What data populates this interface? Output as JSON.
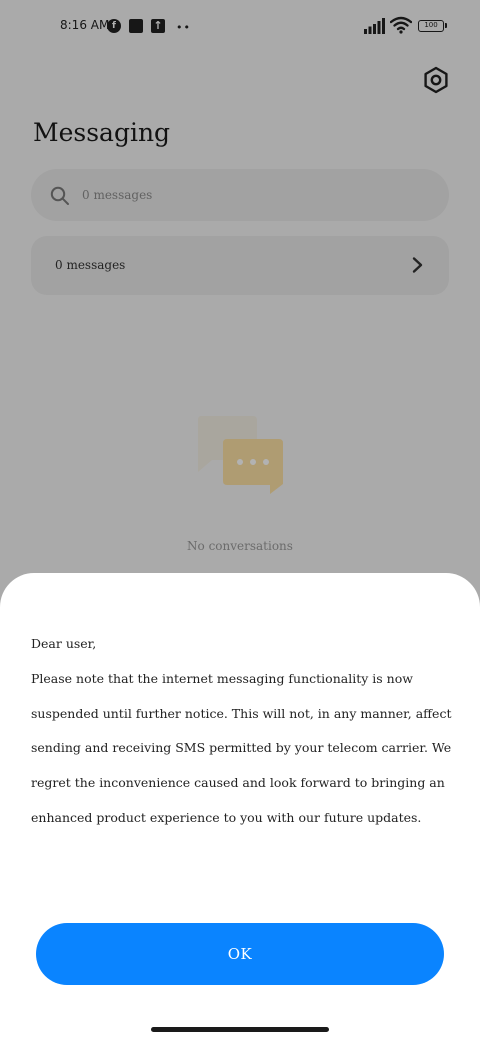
{
  "status_bar": {
    "time": "8:16 AM",
    "battery": "100"
  },
  "header": {
    "title": "Messaging"
  },
  "search": {
    "placeholder": "0 messages"
  },
  "messages_row": {
    "label": "0 messages"
  },
  "empty_state": {
    "text": "No conversations"
  },
  "sheet": {
    "greeting": "Dear user,",
    "body": "Please note that the internet messaging functionality is now suspended until further notice. This will not, in any manner, affect sending and receiving SMS permitted by your telecom carrier. We regret the inconvenience caused and look forward to bringing an enhanced product experience to you with our future updates.",
    "ok_label": "OK"
  },
  "colors": {
    "accent": "#0a84ff",
    "sheet_background": "#ffffff",
    "screen_background": "#f4f4f4"
  },
  "icons": {
    "settings": "settings-hexagon-icon",
    "search": "search-icon",
    "chevron": "chevron-right-icon",
    "empty": "chat-bubbles-icon"
  }
}
